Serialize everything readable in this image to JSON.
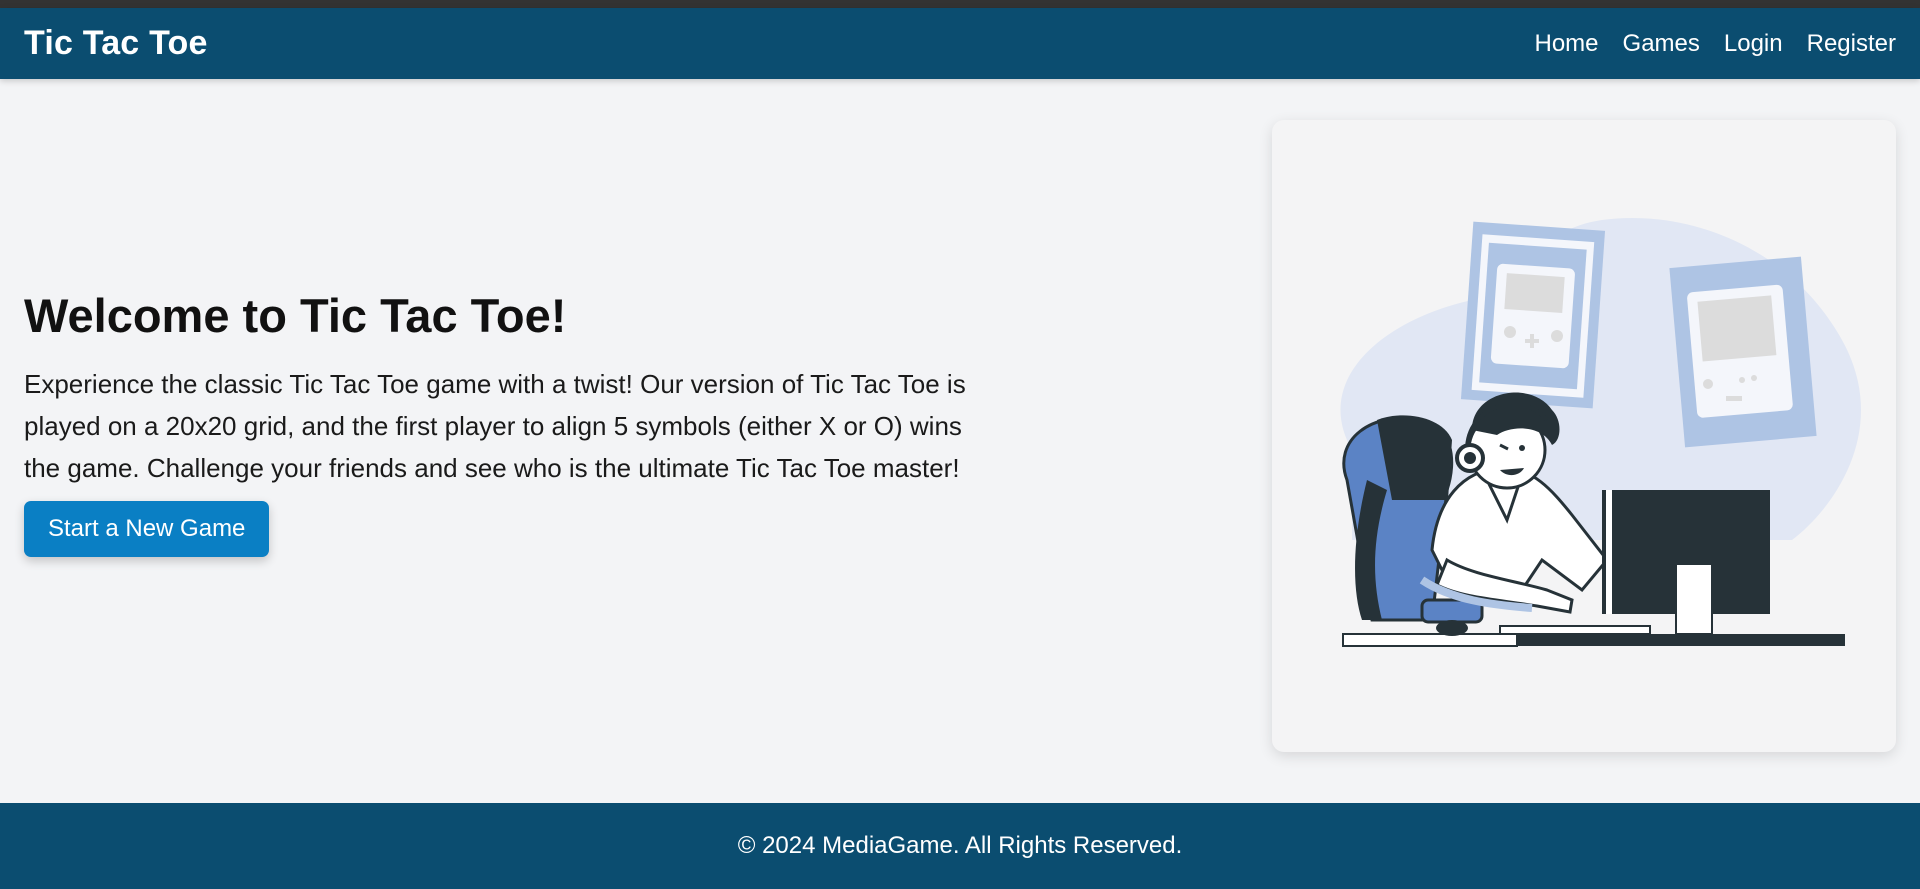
{
  "nav": {
    "brand": "Tic Tac Toe",
    "links": [
      "Home",
      "Games",
      "Login",
      "Register"
    ]
  },
  "hero": {
    "title": "Welcome to Tic Tac Toe!",
    "description": "Experience the classic Tic Tac Toe game with a twist! Our version of Tic Tac Toe is played on a 20x20 grid, and the first player to align 5 symbols (either X or O) wins the game. Challenge your friends and see who is the ultimate Tic Tac Toe master!",
    "cta_label": "Start a New Game"
  },
  "illustration": {
    "icon": "gamer-at-computer-illustration"
  },
  "footer": {
    "text": "© 2024 MediaGame. All Rights Reserved."
  },
  "colors": {
    "nav_bg": "#0b4d70",
    "accent": "#0a7fc4",
    "page_bg": "#f3f4f6"
  }
}
